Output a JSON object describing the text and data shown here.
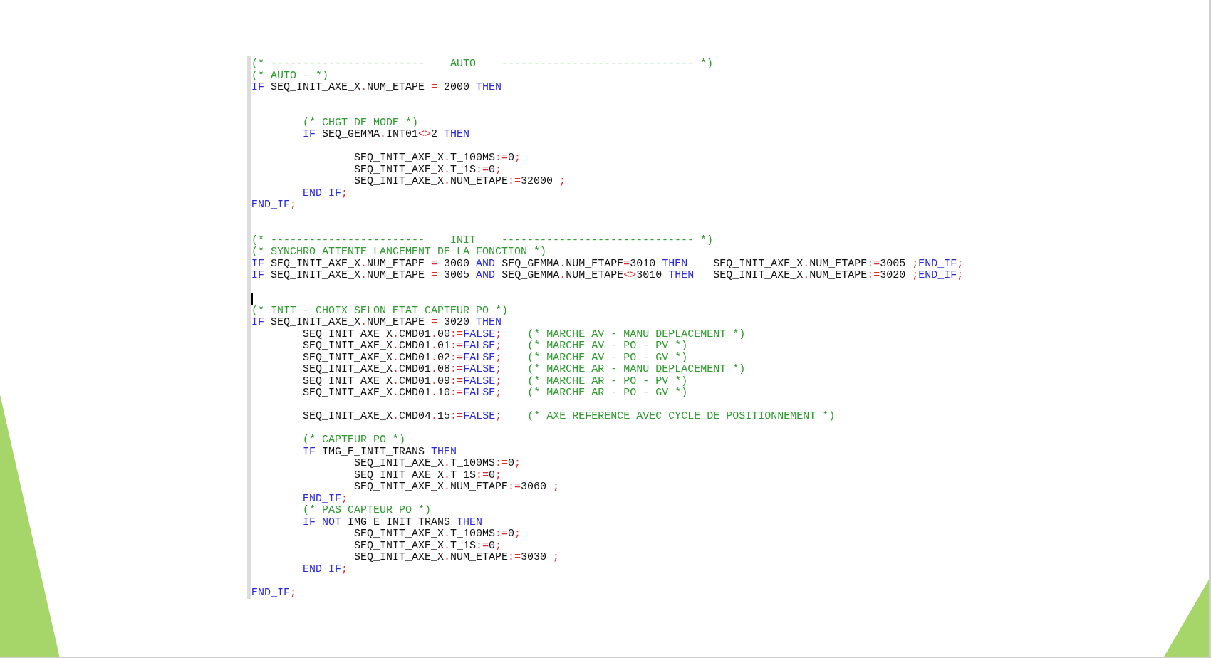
{
  "editor": {
    "lines": [
      {
        "kind": "code",
        "tokens": [
          {
            "kind": "comment",
            "text": "(* ------------------------    AUTO    ------------------------------ *)"
          }
        ]
      },
      {
        "kind": "code",
        "tokens": [
          {
            "kind": "comment",
            "text": "(* AUTO - *)"
          }
        ]
      },
      {
        "kind": "code",
        "tokens": [
          {
            "kind": "keyword",
            "text": "IF"
          },
          {
            "kind": "plain",
            "text": " SEQ_INIT_AXE_X"
          },
          {
            "kind": "operator",
            "text": "."
          },
          {
            "kind": "plain",
            "text": "NUM_ETAPE"
          },
          {
            "kind": "operator",
            "text": " = "
          },
          {
            "kind": "plain",
            "text": "2000 "
          },
          {
            "kind": "keyword",
            "text": "THEN"
          }
        ]
      },
      {
        "kind": "blank"
      },
      {
        "kind": "blank"
      },
      {
        "kind": "code",
        "tokens": [
          {
            "kind": "comment",
            "text": "        (* CHGT DE MODE *)"
          }
        ]
      },
      {
        "kind": "code",
        "tokens": [
          {
            "kind": "keyword",
            "text": "        IF"
          },
          {
            "kind": "plain",
            "text": " SEQ_GEMMA"
          },
          {
            "kind": "operator",
            "text": "."
          },
          {
            "kind": "plain",
            "text": "INT01"
          },
          {
            "kind": "operator",
            "text": "<>"
          },
          {
            "kind": "plain",
            "text": "2 "
          },
          {
            "kind": "keyword",
            "text": "THEN"
          }
        ]
      },
      {
        "kind": "blank"
      },
      {
        "kind": "code",
        "tokens": [
          {
            "kind": "plain",
            "text": "                SEQ_INIT_AXE_X"
          },
          {
            "kind": "operator",
            "text": "."
          },
          {
            "kind": "plain",
            "text": "T_100MS"
          },
          {
            "kind": "operator",
            "text": ":="
          },
          {
            "kind": "plain",
            "text": "0"
          },
          {
            "kind": "operator",
            "text": ";"
          }
        ]
      },
      {
        "kind": "code",
        "tokens": [
          {
            "kind": "plain",
            "text": "                SEQ_INIT_AXE_X"
          },
          {
            "kind": "operator",
            "text": "."
          },
          {
            "kind": "plain",
            "text": "T_1S"
          },
          {
            "kind": "operator",
            "text": ":="
          },
          {
            "kind": "plain",
            "text": "0"
          },
          {
            "kind": "operator",
            "text": ";"
          }
        ]
      },
      {
        "kind": "code",
        "tokens": [
          {
            "kind": "plain",
            "text": "                SEQ_INIT_AXE_X"
          },
          {
            "kind": "operator",
            "text": "."
          },
          {
            "kind": "plain",
            "text": "NUM_ETAPE"
          },
          {
            "kind": "operator",
            "text": ":="
          },
          {
            "kind": "plain",
            "text": "32000 "
          },
          {
            "kind": "operator",
            "text": ";"
          }
        ]
      },
      {
        "kind": "code",
        "tokens": [
          {
            "kind": "keyword",
            "text": "        END_IF"
          },
          {
            "kind": "operator",
            "text": ";"
          }
        ]
      },
      {
        "kind": "code",
        "tokens": [
          {
            "kind": "keyword",
            "text": "END_IF"
          },
          {
            "kind": "operator",
            "text": ";"
          }
        ]
      },
      {
        "kind": "blank"
      },
      {
        "kind": "blank"
      },
      {
        "kind": "code",
        "tokens": [
          {
            "kind": "comment",
            "text": "(* ------------------------    INIT    ------------------------------ *)"
          }
        ]
      },
      {
        "kind": "code",
        "tokens": [
          {
            "kind": "comment",
            "text": "(* SYNCHRO ATTENTE LANCEMENT DE LA FONCTION *)"
          }
        ]
      },
      {
        "kind": "code",
        "tokens": [
          {
            "kind": "keyword",
            "text": "IF"
          },
          {
            "kind": "plain",
            "text": " SEQ_INIT_AXE_X"
          },
          {
            "kind": "operator",
            "text": "."
          },
          {
            "kind": "plain",
            "text": "NUM_ETAPE"
          },
          {
            "kind": "operator",
            "text": " = "
          },
          {
            "kind": "plain",
            "text": "3000 "
          },
          {
            "kind": "keyword",
            "text": "AND"
          },
          {
            "kind": "plain",
            "text": " SEQ_GEMMA"
          },
          {
            "kind": "operator",
            "text": "."
          },
          {
            "kind": "plain",
            "text": "NUM_ETAPE"
          },
          {
            "kind": "operator",
            "text": "="
          },
          {
            "kind": "plain",
            "text": "3010 "
          },
          {
            "kind": "keyword",
            "text": "THEN"
          },
          {
            "kind": "plain",
            "text": "    SEQ_INIT_AXE_X"
          },
          {
            "kind": "operator",
            "text": "."
          },
          {
            "kind": "plain",
            "text": "NUM_ETAPE"
          },
          {
            "kind": "operator",
            "text": ":="
          },
          {
            "kind": "plain",
            "text": "3005 "
          },
          {
            "kind": "operator",
            "text": ";"
          },
          {
            "kind": "keyword",
            "text": "END_IF"
          },
          {
            "kind": "operator",
            "text": ";"
          }
        ]
      },
      {
        "kind": "code",
        "tokens": [
          {
            "kind": "keyword",
            "text": "IF"
          },
          {
            "kind": "plain",
            "text": " SEQ_INIT_AXE_X"
          },
          {
            "kind": "operator",
            "text": "."
          },
          {
            "kind": "plain",
            "text": "NUM_ETAPE"
          },
          {
            "kind": "operator",
            "text": " = "
          },
          {
            "kind": "plain",
            "text": "3005 "
          },
          {
            "kind": "keyword",
            "text": "AND"
          },
          {
            "kind": "plain",
            "text": " SEQ_GEMMA"
          },
          {
            "kind": "operator",
            "text": "."
          },
          {
            "kind": "plain",
            "text": "NUM_ETAPE"
          },
          {
            "kind": "operator",
            "text": "<>"
          },
          {
            "kind": "plain",
            "text": "3010 "
          },
          {
            "kind": "keyword",
            "text": "THEN"
          },
          {
            "kind": "plain",
            "text": "   SEQ_INIT_AXE_X"
          },
          {
            "kind": "operator",
            "text": "."
          },
          {
            "kind": "plain",
            "text": "NUM_ETAPE"
          },
          {
            "kind": "operator",
            "text": ":="
          },
          {
            "kind": "plain",
            "text": "3020 "
          },
          {
            "kind": "operator",
            "text": ";"
          },
          {
            "kind": "keyword",
            "text": "END_IF"
          },
          {
            "kind": "operator",
            "text": ";"
          }
        ]
      },
      {
        "kind": "blank"
      },
      {
        "kind": "cursor"
      },
      {
        "kind": "code",
        "tokens": [
          {
            "kind": "comment",
            "text": "(* INIT - CHOIX SELON ETAT CAPTEUR PO *)"
          }
        ]
      },
      {
        "kind": "code",
        "tokens": [
          {
            "kind": "keyword",
            "text": "IF"
          },
          {
            "kind": "plain",
            "text": " SEQ_INIT_AXE_X"
          },
          {
            "kind": "operator",
            "text": "."
          },
          {
            "kind": "plain",
            "text": "NUM_ETAPE"
          },
          {
            "kind": "operator",
            "text": " = "
          },
          {
            "kind": "plain",
            "text": "3020 "
          },
          {
            "kind": "keyword",
            "text": "THEN"
          }
        ]
      },
      {
        "kind": "code",
        "tokens": [
          {
            "kind": "plain",
            "text": "        SEQ_INIT_AXE_X"
          },
          {
            "kind": "operator",
            "text": "."
          },
          {
            "kind": "plain",
            "text": "CMD01"
          },
          {
            "kind": "operator",
            "text": "."
          },
          {
            "kind": "plain",
            "text": "00"
          },
          {
            "kind": "operator",
            "text": ":="
          },
          {
            "kind": "keyword",
            "text": "FALSE"
          },
          {
            "kind": "operator",
            "text": ";"
          },
          {
            "kind": "comment",
            "text": "    (* MARCHE AV - MANU DEPLACEMENT *)"
          }
        ]
      },
      {
        "kind": "code",
        "tokens": [
          {
            "kind": "plain",
            "text": "        SEQ_INIT_AXE_X"
          },
          {
            "kind": "operator",
            "text": "."
          },
          {
            "kind": "plain",
            "text": "CMD01"
          },
          {
            "kind": "operator",
            "text": "."
          },
          {
            "kind": "plain",
            "text": "01"
          },
          {
            "kind": "operator",
            "text": ":="
          },
          {
            "kind": "keyword",
            "text": "FALSE"
          },
          {
            "kind": "operator",
            "text": ";"
          },
          {
            "kind": "comment",
            "text": "    (* MARCHE AV - PO - PV *)"
          }
        ]
      },
      {
        "kind": "code",
        "tokens": [
          {
            "kind": "plain",
            "text": "        SEQ_INIT_AXE_X"
          },
          {
            "kind": "operator",
            "text": "."
          },
          {
            "kind": "plain",
            "text": "CMD01"
          },
          {
            "kind": "operator",
            "text": "."
          },
          {
            "kind": "plain",
            "text": "02"
          },
          {
            "kind": "operator",
            "text": ":="
          },
          {
            "kind": "keyword",
            "text": "FALSE"
          },
          {
            "kind": "operator",
            "text": ";"
          },
          {
            "kind": "comment",
            "text": "    (* MARCHE AV - PO - GV *)"
          }
        ]
      },
      {
        "kind": "code",
        "tokens": [
          {
            "kind": "plain",
            "text": "        SEQ_INIT_AXE_X"
          },
          {
            "kind": "operator",
            "text": "."
          },
          {
            "kind": "plain",
            "text": "CMD01"
          },
          {
            "kind": "operator",
            "text": "."
          },
          {
            "kind": "plain",
            "text": "08"
          },
          {
            "kind": "operator",
            "text": ":="
          },
          {
            "kind": "keyword",
            "text": "FALSE"
          },
          {
            "kind": "operator",
            "text": ";"
          },
          {
            "kind": "comment",
            "text": "    (* MARCHE AR - MANU DEPLACEMENT *)"
          }
        ]
      },
      {
        "kind": "code",
        "tokens": [
          {
            "kind": "plain",
            "text": "        SEQ_INIT_AXE_X"
          },
          {
            "kind": "operator",
            "text": "."
          },
          {
            "kind": "plain",
            "text": "CMD01"
          },
          {
            "kind": "operator",
            "text": "."
          },
          {
            "kind": "plain",
            "text": "09"
          },
          {
            "kind": "operator",
            "text": ":="
          },
          {
            "kind": "keyword",
            "text": "FALSE"
          },
          {
            "kind": "operator",
            "text": ";"
          },
          {
            "kind": "comment",
            "text": "    (* MARCHE AR - PO - PV *)"
          }
        ]
      },
      {
        "kind": "code",
        "tokens": [
          {
            "kind": "plain",
            "text": "        SEQ_INIT_AXE_X"
          },
          {
            "kind": "operator",
            "text": "."
          },
          {
            "kind": "plain",
            "text": "CMD01"
          },
          {
            "kind": "operator",
            "text": "."
          },
          {
            "kind": "plain",
            "text": "10"
          },
          {
            "kind": "operator",
            "text": ":="
          },
          {
            "kind": "keyword",
            "text": "FALSE"
          },
          {
            "kind": "operator",
            "text": ";"
          },
          {
            "kind": "comment",
            "text": "    (* MARCHE AR - PO - GV *)"
          }
        ]
      },
      {
        "kind": "blank"
      },
      {
        "kind": "code",
        "tokens": [
          {
            "kind": "plain",
            "text": "        SEQ_INIT_AXE_X"
          },
          {
            "kind": "operator",
            "text": "."
          },
          {
            "kind": "plain",
            "text": "CMD04"
          },
          {
            "kind": "operator",
            "text": "."
          },
          {
            "kind": "plain",
            "text": "15"
          },
          {
            "kind": "operator",
            "text": ":="
          },
          {
            "kind": "keyword",
            "text": "FALSE"
          },
          {
            "kind": "operator",
            "text": ";"
          },
          {
            "kind": "comment",
            "text": "    (* AXE REFERENCE AVEC CYCLE DE POSITIONNEMENT *)"
          }
        ]
      },
      {
        "kind": "blank"
      },
      {
        "kind": "code",
        "tokens": [
          {
            "kind": "comment",
            "text": "        (* CAPTEUR PO *)"
          }
        ]
      },
      {
        "kind": "code",
        "tokens": [
          {
            "kind": "keyword",
            "text": "        IF"
          },
          {
            "kind": "plain",
            "text": " IMG_E_INIT_TRANS "
          },
          {
            "kind": "keyword",
            "text": "THEN"
          }
        ]
      },
      {
        "kind": "code",
        "tokens": [
          {
            "kind": "plain",
            "text": "                SEQ_INIT_AXE_X"
          },
          {
            "kind": "operator",
            "text": "."
          },
          {
            "kind": "plain",
            "text": "T_100MS"
          },
          {
            "kind": "operator",
            "text": ":="
          },
          {
            "kind": "plain",
            "text": "0"
          },
          {
            "kind": "operator",
            "text": ";"
          }
        ]
      },
      {
        "kind": "code",
        "tokens": [
          {
            "kind": "plain",
            "text": "                SEQ_INIT_AXE_X"
          },
          {
            "kind": "operator",
            "text": "."
          },
          {
            "kind": "plain",
            "text": "T_1S"
          },
          {
            "kind": "operator",
            "text": ":="
          },
          {
            "kind": "plain",
            "text": "0"
          },
          {
            "kind": "operator",
            "text": ";"
          }
        ]
      },
      {
        "kind": "code",
        "tokens": [
          {
            "kind": "plain",
            "text": "                SEQ_INIT_AXE_X"
          },
          {
            "kind": "operator",
            "text": "."
          },
          {
            "kind": "plain",
            "text": "NUM_ETAPE"
          },
          {
            "kind": "operator",
            "text": ":="
          },
          {
            "kind": "plain",
            "text": "3060 "
          },
          {
            "kind": "operator",
            "text": ";"
          }
        ]
      },
      {
        "kind": "code",
        "tokens": [
          {
            "kind": "keyword",
            "text": "        END_IF"
          },
          {
            "kind": "operator",
            "text": ";"
          }
        ]
      },
      {
        "kind": "code",
        "tokens": [
          {
            "kind": "comment",
            "text": "        (* PAS CAPTEUR PO *)"
          }
        ]
      },
      {
        "kind": "code",
        "tokens": [
          {
            "kind": "keyword",
            "text": "        IF NOT"
          },
          {
            "kind": "plain",
            "text": " IMG_E_INIT_TRANS "
          },
          {
            "kind": "keyword",
            "text": "THEN"
          }
        ]
      },
      {
        "kind": "code",
        "tokens": [
          {
            "kind": "plain",
            "text": "                SEQ_INIT_AXE_X"
          },
          {
            "kind": "operator",
            "text": "."
          },
          {
            "kind": "plain",
            "text": "T_100MS"
          },
          {
            "kind": "operator",
            "text": ":="
          },
          {
            "kind": "plain",
            "text": "0"
          },
          {
            "kind": "operator",
            "text": ";"
          }
        ]
      },
      {
        "kind": "code",
        "tokens": [
          {
            "kind": "plain",
            "text": "                SEQ_INIT_AXE_X"
          },
          {
            "kind": "operator",
            "text": "."
          },
          {
            "kind": "plain",
            "text": "T_1S"
          },
          {
            "kind": "operator",
            "text": ":="
          },
          {
            "kind": "plain",
            "text": "0"
          },
          {
            "kind": "operator",
            "text": ";"
          }
        ]
      },
      {
        "kind": "code",
        "tokens": [
          {
            "kind": "plain",
            "text": "                SEQ_INIT_AXE_X"
          },
          {
            "kind": "operator",
            "text": "."
          },
          {
            "kind": "plain",
            "text": "NUM_ETAPE"
          },
          {
            "kind": "operator",
            "text": ":="
          },
          {
            "kind": "plain",
            "text": "3030 "
          },
          {
            "kind": "operator",
            "text": ";"
          }
        ]
      },
      {
        "kind": "code",
        "tokens": [
          {
            "kind": "keyword",
            "text": "        END_IF"
          },
          {
            "kind": "operator",
            "text": ";"
          }
        ]
      },
      {
        "kind": "blank"
      },
      {
        "kind": "code",
        "tokens": [
          {
            "kind": "keyword",
            "text": "END_IF"
          },
          {
            "kind": "operator",
            "text": ";"
          }
        ]
      }
    ]
  }
}
